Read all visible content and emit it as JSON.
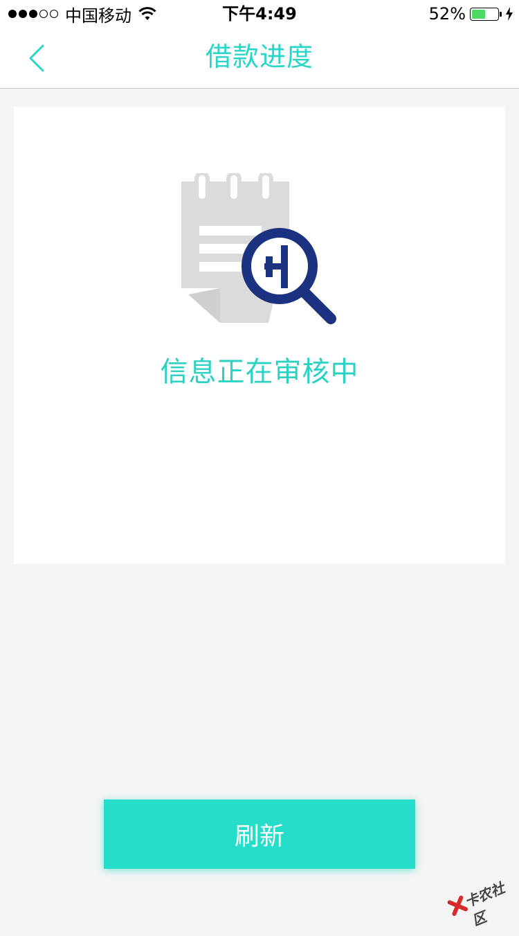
{
  "status_bar": {
    "signal_dots_filled": 3,
    "signal_dots_total": 5,
    "carrier": "中国移动",
    "time": "下午4:49",
    "battery_percent_label": "52%",
    "battery_level": 0.52,
    "wifi_icon": "wifi-icon",
    "charging_icon": "bolt-icon"
  },
  "nav": {
    "back_icon": "chevron-left-icon",
    "title": "借款进度"
  },
  "card": {
    "illustration_icon": "document-search-icon",
    "status_text": "信息正在审核中"
  },
  "actions": {
    "refresh_label": "刷新"
  },
  "watermark": {
    "text": "卡农社区"
  },
  "colors": {
    "accent": "#27d6c6",
    "button": "#26ddc9",
    "magnifier": "#1a3280",
    "document": "#d9d9d9",
    "background": "#f4f4f4"
  }
}
